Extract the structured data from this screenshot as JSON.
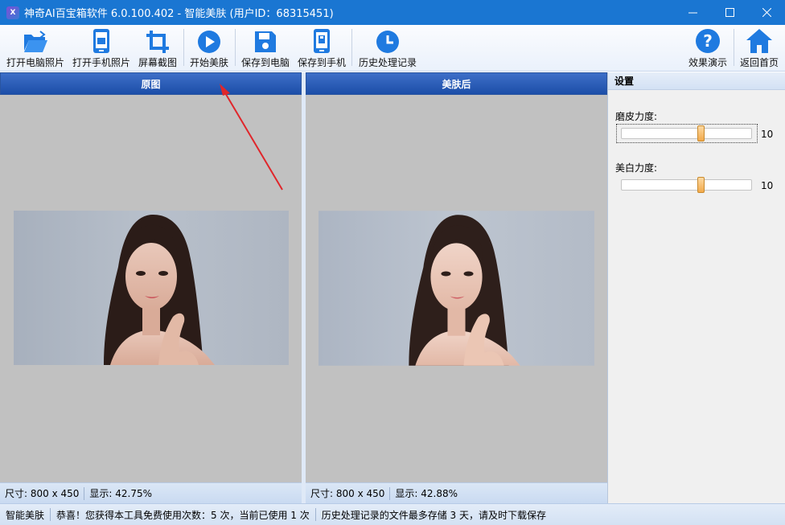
{
  "window": {
    "title": "神奇AI百宝箱软件 6.0.100.402 - 智能美肤 (用户ID：68315451)",
    "app_icon_text": "X"
  },
  "toolbar": {
    "open_pc_photo": "打开电脑照片",
    "open_phone_photo": "打开手机照片",
    "screenshot": "屏幕截图",
    "start_beautify": "开始美肤",
    "save_to_pc": "保存到电脑",
    "save_to_phone": "保存到手机",
    "history": "历史处理记录",
    "demo": "效果演示",
    "home": "返回首页"
  },
  "left_panel": {
    "header": "原图",
    "size_text": "尺寸: 800 x 450",
    "zoom_text": "显示: 42.75%"
  },
  "right_panel": {
    "header": "美肤后",
    "size_text": "尺寸: 800 x 450",
    "zoom_text": "显示: 42.88%"
  },
  "settings": {
    "header": "设置",
    "smooth_label": "磨皮力度:",
    "smooth_value": "10",
    "whiten_label": "美白力度:",
    "whiten_value": "10",
    "smooth_level_fraction": 0.62,
    "whiten_level_fraction": 0.62
  },
  "statusbar": {
    "module": "智能美肤",
    "usage_notice": "恭喜！您获得本工具免费使用次数：5 次，当前已使用 1 次",
    "history_notice": "历史处理记录的文件最多存储 3 天，请及时下载保存"
  },
  "colors": {
    "titlebar": "#1a76d2",
    "icon_blue": "#1f7ae0",
    "arrow_red": "#e0262b",
    "slider_thumb": "#f2a94a"
  }
}
